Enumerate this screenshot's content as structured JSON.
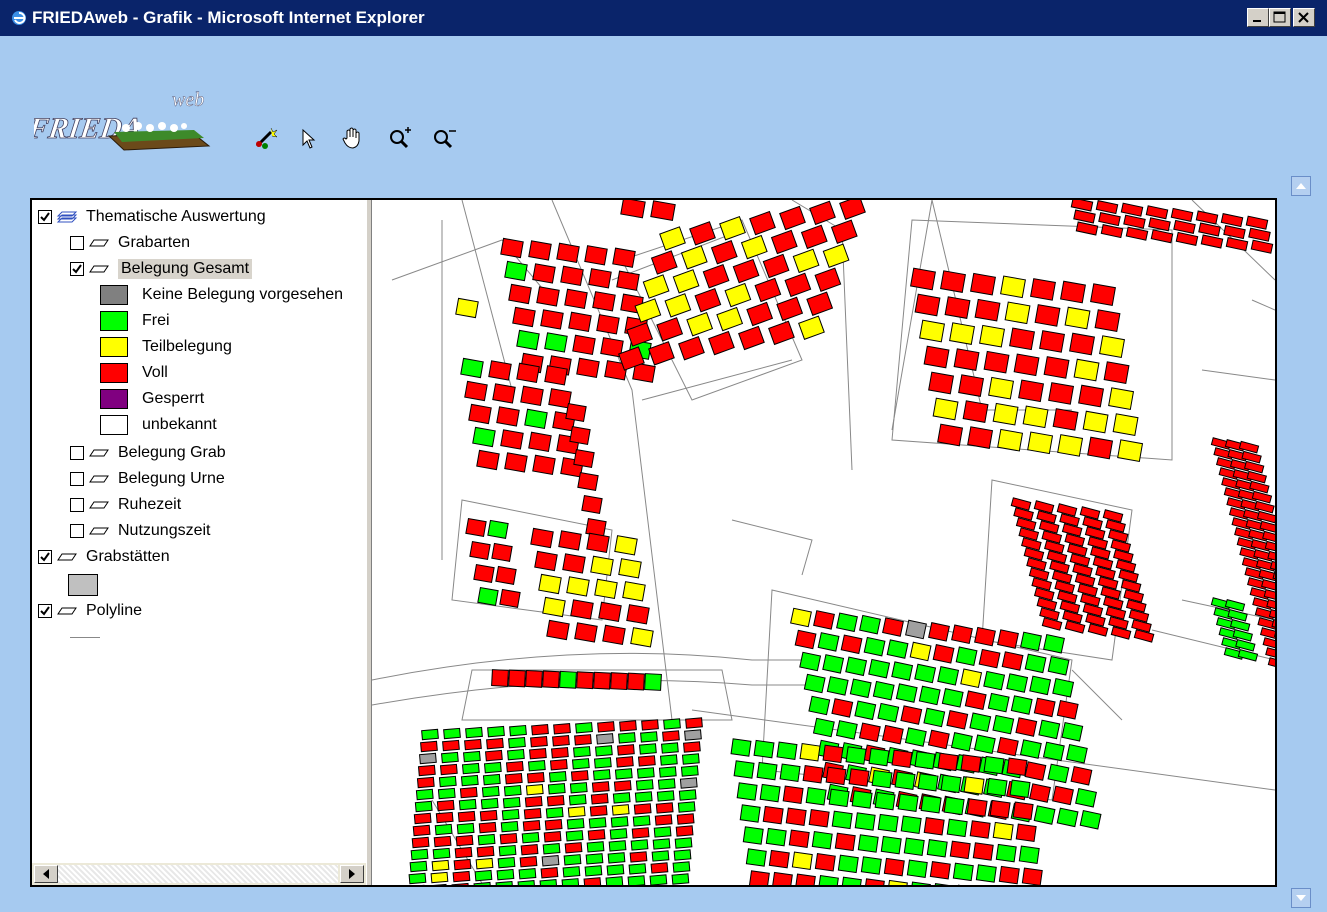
{
  "window": {
    "title": "FRIEDAweb - Grafik - Microsoft Internet Explorer",
    "titlebar_color": "#0a246a"
  },
  "logo": {
    "text": "FRIEDA",
    "suffix": "web"
  },
  "toolbar": {
    "tools": [
      "magic-wand-icon",
      "pointer-icon",
      "pan-hand-icon",
      "zoom-in-icon",
      "zoom-out-icon"
    ]
  },
  "layers": {
    "root": {
      "label": "Thematische Auswertung",
      "checked": true
    },
    "items": [
      {
        "label": "Grabarten",
        "checked": false
      },
      {
        "label": "Belegung Gesamt",
        "checked": true,
        "selected": true
      },
      {
        "label": "Belegung Grab",
        "checked": false
      },
      {
        "label": "Belegung Urne",
        "checked": false
      },
      {
        "label": "Ruhezeit",
        "checked": false
      },
      {
        "label": "Nutzungszeit",
        "checked": false
      }
    ],
    "legend": [
      {
        "label": "Keine Belegung vorgesehen",
        "color": "#808080"
      },
      {
        "label": "Frei",
        "color": "#00ff00"
      },
      {
        "label": "Teilbelegung",
        "color": "#ffff00"
      },
      {
        "label": "Voll",
        "color": "#ff0000"
      },
      {
        "label": "Gesperrt",
        "color": "#800080"
      },
      {
        "label": "unbekannt",
        "color": "#ffffff"
      }
    ],
    "grabstaetten": {
      "label": "Grabstätten",
      "checked": true,
      "swatch": "#c0c0c0"
    },
    "polyline": {
      "label": "Polyline",
      "checked": true
    }
  },
  "colors": {
    "background": "#a6caf0",
    "red": "#ff0000",
    "green": "#00ff00",
    "yellow": "#ffff00",
    "gray": "#a0a0a0"
  }
}
